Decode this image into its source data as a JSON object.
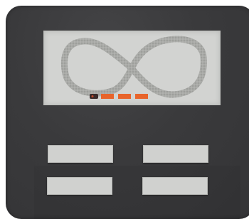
{
  "screen": {
    "track": "figure-eight",
    "train": {
      "locomotive_color": "#3a2a2a",
      "car_color": "#e8642b",
      "cars": 3
    },
    "track_color": "#a9aaa7"
  },
  "controls": {
    "buttons": [
      {
        "label": ""
      },
      {
        "label": ""
      },
      {
        "label": ""
      },
      {
        "label": ""
      }
    ]
  },
  "colors": {
    "device": "#3a3a3c",
    "screen": "#d2d3d1",
    "button": "#d0d1cf"
  }
}
